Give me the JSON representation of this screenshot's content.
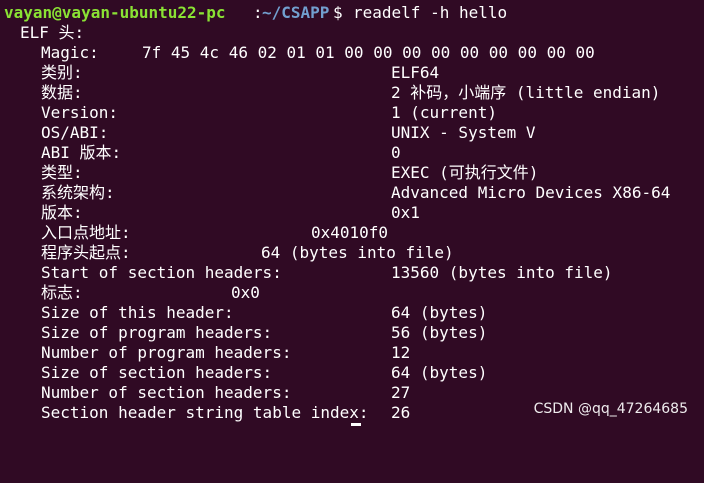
{
  "prompt": {
    "user_host": "vayan@vayan-ubuntu22-pc",
    "colon": ":",
    "path": "~/CSAPP",
    "dollar": "$",
    "command": "readelf -h hello"
  },
  "header_line": "ELF 头:",
  "rows": [
    {
      "label": "Magic:",
      "value": "7f 45 4c 46 02 01 01 00 00 00 00 00 00 00 00 00"
    },
    {
      "label": "类别:",
      "value": "ELF64"
    },
    {
      "label": "数据:",
      "value": "2 补码，小端序 (little endian)"
    },
    {
      "label": "Version:",
      "value": "1 (current)"
    },
    {
      "label": "OS/ABI:",
      "value": "UNIX - System V"
    },
    {
      "label": "ABI 版本:",
      "value": "0"
    },
    {
      "label": "类型:",
      "value": "EXEC (可执行文件)"
    },
    {
      "label": "系统架构:",
      "value": "Advanced Micro Devices X86-64"
    },
    {
      "label": "版本:",
      "value": "0x1"
    },
    {
      "label": "入口点地址:",
      "value": "0x4010f0"
    },
    {
      "label": "程序头起点:",
      "value": "64 (bytes into file)"
    },
    {
      "label": "Start of section headers:",
      "value": "13560 (bytes into file)"
    },
    {
      "label": "标志:",
      "value": "0x0"
    },
    {
      "label": "Size of this header:",
      "value": "64 (bytes)"
    },
    {
      "label": "Size of program headers:",
      "value": "56 (bytes)"
    },
    {
      "label": "Number of program headers:",
      "value": "12"
    },
    {
      "label": "Size of section headers:",
      "value": "64 (bytes)"
    },
    {
      "label": "Number of section headers:",
      "value": "27"
    },
    {
      "label": "Section header string table index:",
      "value": "26"
    }
  ],
  "watermark": "CSDN @qq_47264685",
  "colors": {
    "background": "#300a24",
    "prompt_user": "#8ae234",
    "prompt_path": "#729fcf",
    "text": "#ffffff"
  }
}
